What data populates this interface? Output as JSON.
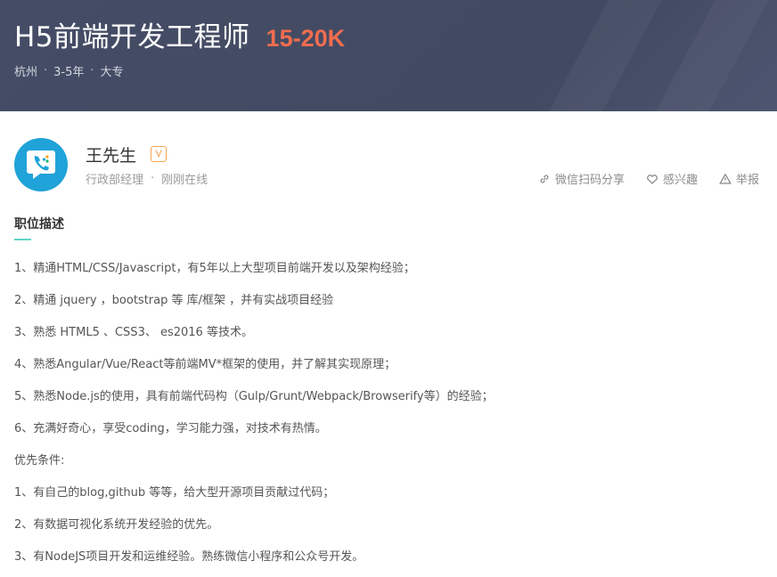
{
  "header": {
    "job_title": "H5前端开发工程师",
    "salary": "15-20K",
    "city": "杭州",
    "experience": "3-5年",
    "education": "大专",
    "separator": "·"
  },
  "recruiter": {
    "name": "王先生",
    "verify_badge": "V",
    "position": "行政部经理",
    "separator": "·",
    "status": "刚刚在线"
  },
  "actions": {
    "share": "微信扫码分享",
    "interest": "感兴趣",
    "report": "举报"
  },
  "description": {
    "title": "职位描述",
    "lines": [
      "1、精通HTML/CSS/Javascript，有5年以上大型项目前端开发以及架构经验；",
      "2、精通 jquery ，bootstrap 等 库/框架 ，并有实战项目经验",
      "3、熟悉 HTML5 、CSS3、 es2016 等技术。",
      "4、熟悉Angular/Vue/React等前端MV*框架的使用，并了解其实现原理；",
      "5、熟悉Node.js的使用，具有前端代码构（Gulp/Grunt/Webpack/Browserify等）的经验；",
      "6、充满好奇心，享受coding，学习能力强，对技术有热情。",
      "优先条件:",
      "1、有自己的blog,github 等等，给大型开源项目贡献过代码；",
      "2、有数据可视化系统开发经验的优先。",
      "3、有NodeJS项目开发和运维经验。熟练微信小程序和公众号开发。"
    ]
  },
  "colors": {
    "banner": "#454d66",
    "salary": "#f26d4f",
    "accent": "#5dd5c8",
    "avatar": "#1fa3d8"
  },
  "icons": {
    "share": "link-icon",
    "interest": "heart-icon",
    "report": "warning-icon",
    "avatar": "phone-logo-icon"
  }
}
